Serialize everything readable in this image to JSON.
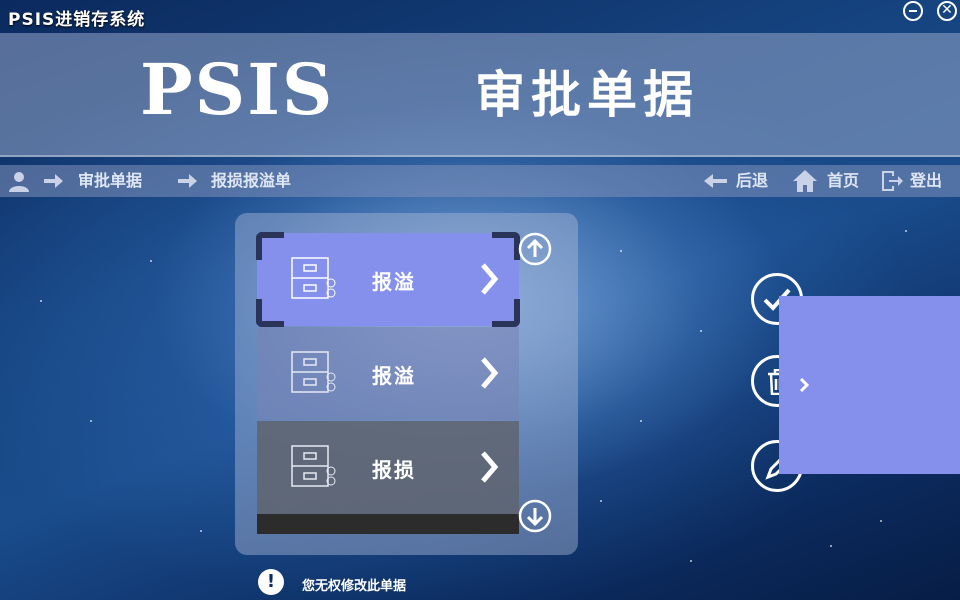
{
  "window": {
    "title": "PSIS进销存系统",
    "minimize_icon": "minus-circle-icon",
    "close_icon": "close-circle-icon",
    "close_glyph": "✕"
  },
  "header": {
    "logo": "PSIS",
    "title": "审批单据"
  },
  "breadcrumb": {
    "user_icon": "user-icon",
    "items": [
      "审批单据",
      "报损报溢单"
    ]
  },
  "nav_actions": {
    "back": {
      "label": "后退",
      "icon": "arrow-left-icon"
    },
    "home": {
      "label": "首页",
      "icon": "home-icon"
    },
    "logout": {
      "label": "登出",
      "icon": "logout-icon"
    }
  },
  "list": {
    "items": [
      {
        "label": "报溢",
        "icon": "file-cabinet-icon",
        "selected": true
      },
      {
        "label": "报溢",
        "icon": "file-cabinet-icon",
        "selected": false
      },
      {
        "label": "报损",
        "icon": "file-cabinet-icon",
        "selected": false
      }
    ],
    "scroll_up_icon": "arrow-up-circle-icon",
    "scroll_down_icon": "arrow-down-circle-icon"
  },
  "actions": {
    "approve_icon": "check-icon",
    "delete_icon": "trash-icon",
    "edit_icon": "pencil-icon"
  },
  "warning": {
    "icon_glyph": "!",
    "text": "您无权修改此单据"
  },
  "colors": {
    "accent": "#8490ec",
    "header_band": "#96a5c8",
    "background_dark": "#0b2a5e"
  }
}
